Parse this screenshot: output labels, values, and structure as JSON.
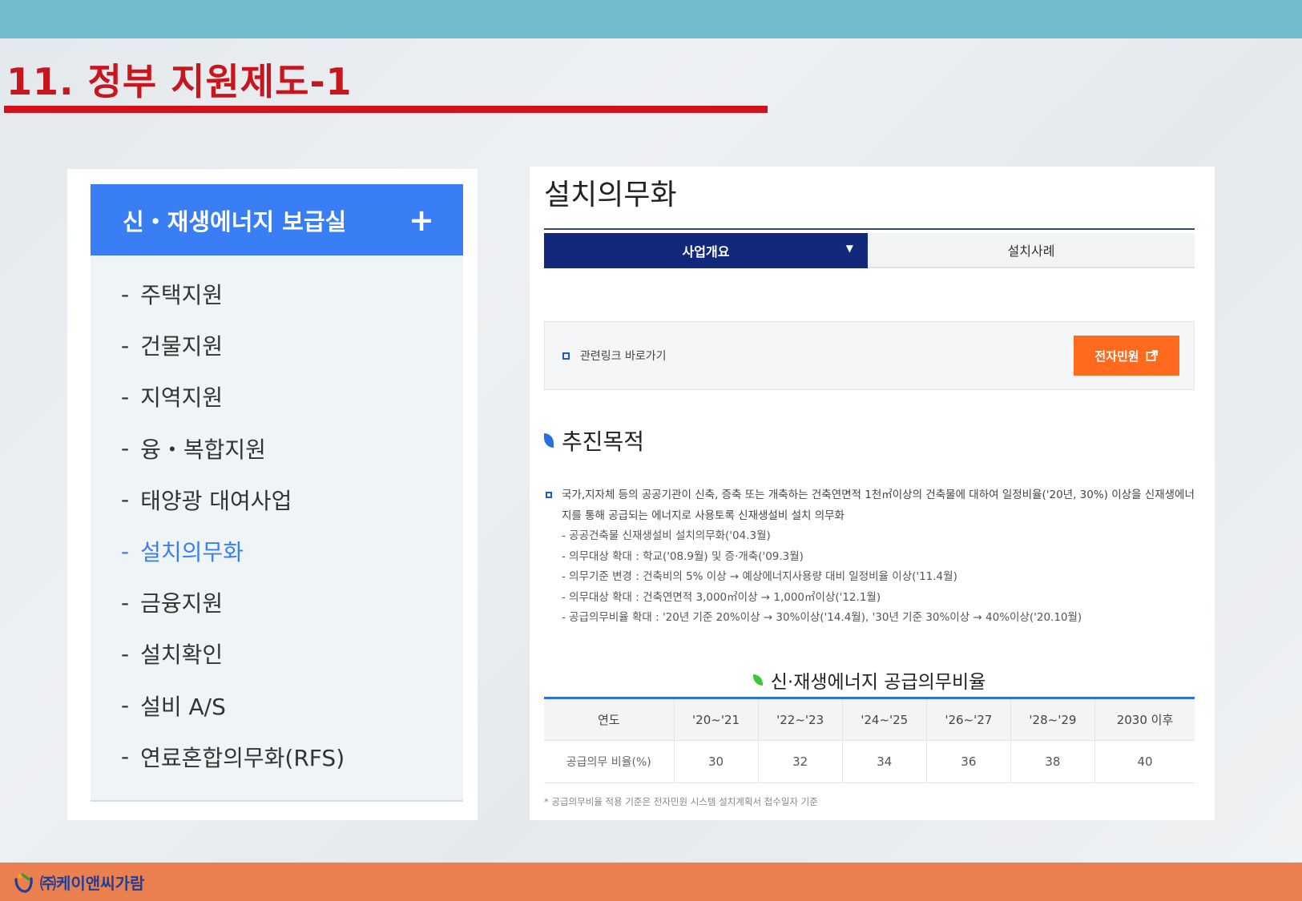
{
  "slide": {
    "title": "11. 정부 지원제도-1"
  },
  "sidebar": {
    "header": "신・재생에너지 보급실",
    "expand_symbol": "+",
    "items": [
      {
        "label": "주택지원"
      },
      {
        "label": "건물지원"
      },
      {
        "label": "지역지원"
      },
      {
        "label": "융・복합지원"
      },
      {
        "label": "태양광 대여사업"
      },
      {
        "label": "설치의무화",
        "active": true
      },
      {
        "label": "금융지원"
      },
      {
        "label": "설치확인"
      },
      {
        "label": "설비 A/S"
      },
      {
        "label": "연료혼합의무화(RFS)"
      }
    ]
  },
  "content": {
    "title": "설치의무화",
    "tabs": [
      {
        "label": "사업개요",
        "active": true
      },
      {
        "label": "설치사례",
        "active": false
      }
    ],
    "related_link": {
      "label": "관련링크 바로가기",
      "button": "전자민원"
    },
    "section_title": "추진목적",
    "paragraph": "국가,지자체 등의 공공기관이 신축, 증축 또는 개축하는 건축연면적 1천㎡이상의 건축물에 대하여 일정비율('20년, 30%) 이상을 신재생에너지를 통해 공급되는 에너지로 사용토록 신재생설비 설치 의무화",
    "sub_items": [
      "- 공공건축물 신재생설비 설치의무화('04.3월)",
      "- 의무대상 확대 : 학교('08.9월) 및 증·개축('09.3월)",
      "- 의무기준 변경 : 건축비의 5% 이상 → 예상에너지사용량 대비 일정비율 이상('11.4월)",
      "- 의무대상 확대 : 건축연면적 3,000㎡이상 → 1,000㎡이상('12.1월)",
      "- 공급의무비율 확대 : '20년 기준 20%이상 → 30%이상('14.4월), '30년 기준 30%이상 → 40%이상('20.10월)"
    ],
    "table": {
      "title": "신·재생에너지 공급의무비율",
      "headers": [
        "연도",
        "'20~'21",
        "'22~'23",
        "'24~'25",
        "'26~'27",
        "'28~'29",
        "2030 이후"
      ],
      "row_label": "공급의무 비율(%)",
      "values": [
        "30",
        "32",
        "34",
        "36",
        "38",
        "40"
      ]
    },
    "footnote": "* 공급의무비율 적용 기준은 전자민원 시스템 설치계획서 접수일자 기준"
  },
  "footer": {
    "company": "㈜케이앤씨가람"
  },
  "colors": {
    "accent_blue": "#3a7ef6",
    "navy_tab": "#12287a",
    "title_red": "#c8161e",
    "orange_button": "#ff6a1e",
    "top_band": "#73bccf",
    "bottom_band": "#ea8050"
  }
}
